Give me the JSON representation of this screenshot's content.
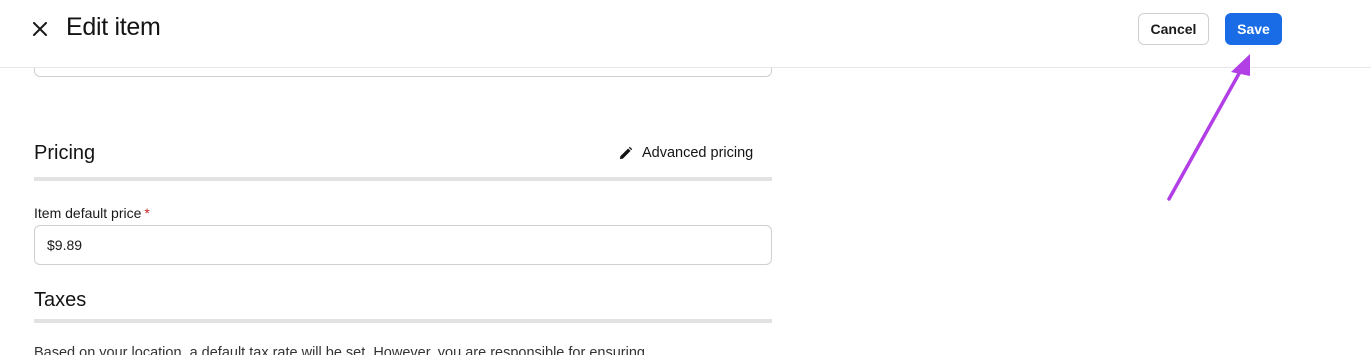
{
  "header": {
    "title": "Edit item",
    "cancel_label": "Cancel",
    "save_label": "Save"
  },
  "pricing": {
    "title": "Pricing",
    "advanced_label": "Advanced pricing",
    "price_label": "Item default price",
    "required_mark": "*",
    "price_value": "$9.89"
  },
  "taxes": {
    "title": "Taxes",
    "note": "Based on your location, a default tax rate will be set. However, you are responsible for ensuring"
  },
  "colors": {
    "accent": "#1a6ce6",
    "annotation_arrow": "#b23ee6",
    "required": "#c0262d"
  },
  "icons": {
    "close": "close-icon",
    "advanced": "pencil-icon"
  }
}
